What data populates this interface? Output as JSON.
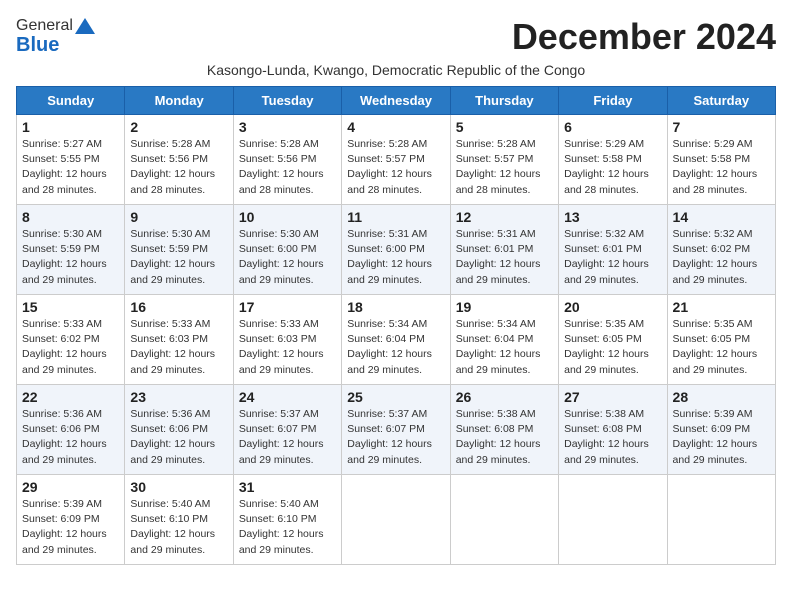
{
  "header": {
    "logo_general": "General",
    "logo_blue": "Blue",
    "month_title": "December 2024",
    "subtitle": "Kasongo-Lunda, Kwango, Democratic Republic of the Congo"
  },
  "weekdays": [
    "Sunday",
    "Monday",
    "Tuesday",
    "Wednesday",
    "Thursday",
    "Friday",
    "Saturday"
  ],
  "weeks": [
    [
      {
        "day": 1,
        "lines": [
          "Sunrise: 5:27 AM",
          "Sunset: 5:55 PM",
          "Daylight: 12 hours",
          "and 28 minutes."
        ]
      },
      {
        "day": 2,
        "lines": [
          "Sunrise: 5:28 AM",
          "Sunset: 5:56 PM",
          "Daylight: 12 hours",
          "and 28 minutes."
        ]
      },
      {
        "day": 3,
        "lines": [
          "Sunrise: 5:28 AM",
          "Sunset: 5:56 PM",
          "Daylight: 12 hours",
          "and 28 minutes."
        ]
      },
      {
        "day": 4,
        "lines": [
          "Sunrise: 5:28 AM",
          "Sunset: 5:57 PM",
          "Daylight: 12 hours",
          "and 28 minutes."
        ]
      },
      {
        "day": 5,
        "lines": [
          "Sunrise: 5:28 AM",
          "Sunset: 5:57 PM",
          "Daylight: 12 hours",
          "and 28 minutes."
        ]
      },
      {
        "day": 6,
        "lines": [
          "Sunrise: 5:29 AM",
          "Sunset: 5:58 PM",
          "Daylight: 12 hours",
          "and 28 minutes."
        ]
      },
      {
        "day": 7,
        "lines": [
          "Sunrise: 5:29 AM",
          "Sunset: 5:58 PM",
          "Daylight: 12 hours",
          "and 28 minutes."
        ]
      }
    ],
    [
      {
        "day": 8,
        "lines": [
          "Sunrise: 5:30 AM",
          "Sunset: 5:59 PM",
          "Daylight: 12 hours",
          "and 29 minutes."
        ]
      },
      {
        "day": 9,
        "lines": [
          "Sunrise: 5:30 AM",
          "Sunset: 5:59 PM",
          "Daylight: 12 hours",
          "and 29 minutes."
        ]
      },
      {
        "day": 10,
        "lines": [
          "Sunrise: 5:30 AM",
          "Sunset: 6:00 PM",
          "Daylight: 12 hours",
          "and 29 minutes."
        ]
      },
      {
        "day": 11,
        "lines": [
          "Sunrise: 5:31 AM",
          "Sunset: 6:00 PM",
          "Daylight: 12 hours",
          "and 29 minutes."
        ]
      },
      {
        "day": 12,
        "lines": [
          "Sunrise: 5:31 AM",
          "Sunset: 6:01 PM",
          "Daylight: 12 hours",
          "and 29 minutes."
        ]
      },
      {
        "day": 13,
        "lines": [
          "Sunrise: 5:32 AM",
          "Sunset: 6:01 PM",
          "Daylight: 12 hours",
          "and 29 minutes."
        ]
      },
      {
        "day": 14,
        "lines": [
          "Sunrise: 5:32 AM",
          "Sunset: 6:02 PM",
          "Daylight: 12 hours",
          "and 29 minutes."
        ]
      }
    ],
    [
      {
        "day": 15,
        "lines": [
          "Sunrise: 5:33 AM",
          "Sunset: 6:02 PM",
          "Daylight: 12 hours",
          "and 29 minutes."
        ]
      },
      {
        "day": 16,
        "lines": [
          "Sunrise: 5:33 AM",
          "Sunset: 6:03 PM",
          "Daylight: 12 hours",
          "and 29 minutes."
        ]
      },
      {
        "day": 17,
        "lines": [
          "Sunrise: 5:33 AM",
          "Sunset: 6:03 PM",
          "Daylight: 12 hours",
          "and 29 minutes."
        ]
      },
      {
        "day": 18,
        "lines": [
          "Sunrise: 5:34 AM",
          "Sunset: 6:04 PM",
          "Daylight: 12 hours",
          "and 29 minutes."
        ]
      },
      {
        "day": 19,
        "lines": [
          "Sunrise: 5:34 AM",
          "Sunset: 6:04 PM",
          "Daylight: 12 hours",
          "and 29 minutes."
        ]
      },
      {
        "day": 20,
        "lines": [
          "Sunrise: 5:35 AM",
          "Sunset: 6:05 PM",
          "Daylight: 12 hours",
          "and 29 minutes."
        ]
      },
      {
        "day": 21,
        "lines": [
          "Sunrise: 5:35 AM",
          "Sunset: 6:05 PM",
          "Daylight: 12 hours",
          "and 29 minutes."
        ]
      }
    ],
    [
      {
        "day": 22,
        "lines": [
          "Sunrise: 5:36 AM",
          "Sunset: 6:06 PM",
          "Daylight: 12 hours",
          "and 29 minutes."
        ]
      },
      {
        "day": 23,
        "lines": [
          "Sunrise: 5:36 AM",
          "Sunset: 6:06 PM",
          "Daylight: 12 hours",
          "and 29 minutes."
        ]
      },
      {
        "day": 24,
        "lines": [
          "Sunrise: 5:37 AM",
          "Sunset: 6:07 PM",
          "Daylight: 12 hours",
          "and 29 minutes."
        ]
      },
      {
        "day": 25,
        "lines": [
          "Sunrise: 5:37 AM",
          "Sunset: 6:07 PM",
          "Daylight: 12 hours",
          "and 29 minutes."
        ]
      },
      {
        "day": 26,
        "lines": [
          "Sunrise: 5:38 AM",
          "Sunset: 6:08 PM",
          "Daylight: 12 hours",
          "and 29 minutes."
        ]
      },
      {
        "day": 27,
        "lines": [
          "Sunrise: 5:38 AM",
          "Sunset: 6:08 PM",
          "Daylight: 12 hours",
          "and 29 minutes."
        ]
      },
      {
        "day": 28,
        "lines": [
          "Sunrise: 5:39 AM",
          "Sunset: 6:09 PM",
          "Daylight: 12 hours",
          "and 29 minutes."
        ]
      }
    ],
    [
      {
        "day": 29,
        "lines": [
          "Sunrise: 5:39 AM",
          "Sunset: 6:09 PM",
          "Daylight: 12 hours",
          "and 29 minutes."
        ]
      },
      {
        "day": 30,
        "lines": [
          "Sunrise: 5:40 AM",
          "Sunset: 6:10 PM",
          "Daylight: 12 hours",
          "and 29 minutes."
        ]
      },
      {
        "day": 31,
        "lines": [
          "Sunrise: 5:40 AM",
          "Sunset: 6:10 PM",
          "Daylight: 12 hours",
          "and 29 minutes."
        ]
      },
      null,
      null,
      null,
      null
    ]
  ]
}
